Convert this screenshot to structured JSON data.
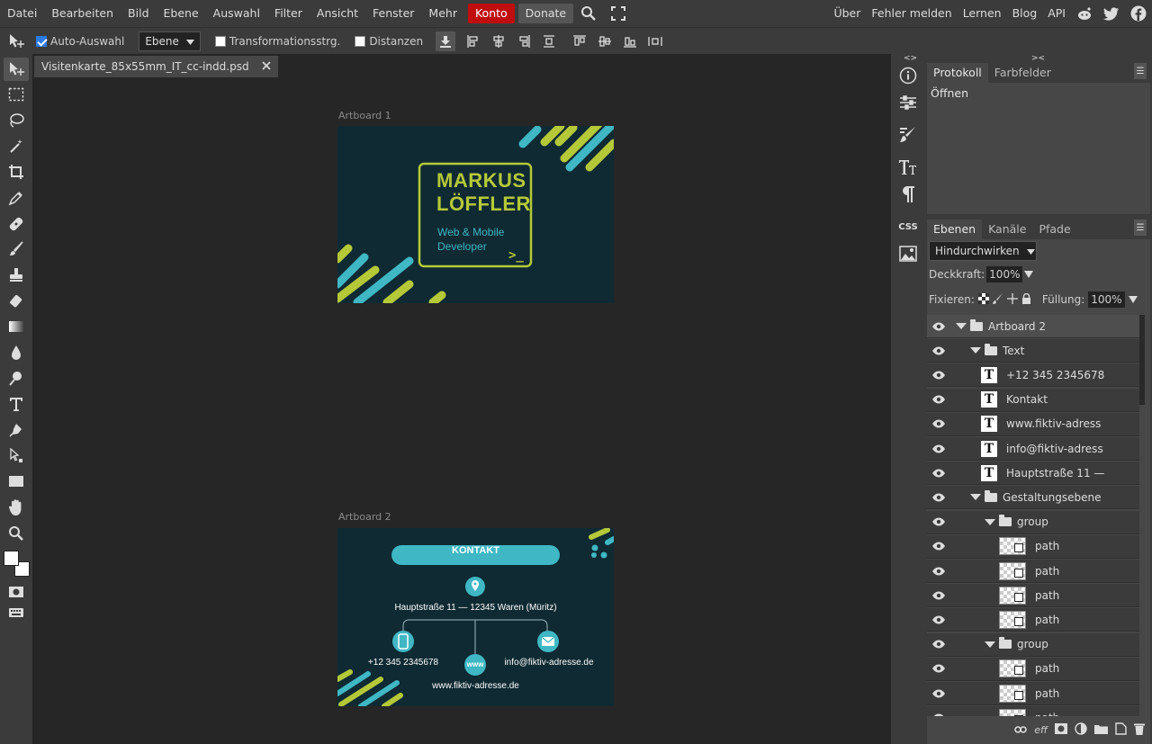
{
  "menu": {
    "items": [
      "Datei",
      "Bearbeiten",
      "Bild",
      "Ebene",
      "Auswahl",
      "Filter",
      "Ansicht",
      "Fenster",
      "Mehr"
    ],
    "konto": "Konto",
    "donate": "Donate",
    "right_items": [
      "Über",
      "Fehler melden",
      "Lernen",
      "Blog",
      "API"
    ]
  },
  "options": {
    "auto_select_label": "Auto-Auswahl",
    "auto_select_checked": true,
    "target_select": "Ebene",
    "transform_label": "Transformationsstrg.",
    "transform_checked": false,
    "distances_label": "Distanzen",
    "distances_checked": false
  },
  "document": {
    "tab_title": "Visitenkarte_85x55mm_IT_cc-indd.psd",
    "artboard1_label": "Artboard 1",
    "artboard2_label": "Artboard 2",
    "card_front": {
      "name_line1": "MARKUS",
      "name_line2": "LÖFFLER",
      "role_line1": "Web & Mobile",
      "role_line2": "Developer",
      "prompt_symbol": ">_"
    },
    "card_back": {
      "heading": "KONTAKT",
      "address": "Hauptstraße 11 — 12345 Waren (Müritz)",
      "phone": "+12 345 2345678",
      "email": "info@fiktiv-adresse.de",
      "web_badge": "www",
      "website": "www.fiktiv-adresse.de"
    },
    "colors": {
      "card_bg": "#0f2a33",
      "accent_teal": "#3fb7c4",
      "accent_lime": "#b5c938"
    }
  },
  "panels": {
    "history_tabs": [
      "Protokoll",
      "Farbfelder"
    ],
    "history_items": [
      "Öffnen"
    ],
    "layers_tabs": [
      "Ebenen",
      "Kanäle",
      "Pfade"
    ],
    "blend_mode": "Hindurchwirken",
    "opacity_label": "Deckkraft:",
    "opacity_value": "100%",
    "lock_label": "Fixieren:",
    "fill_label": "Füllung:",
    "fill_value": "100%",
    "mid_css_label": "CSS",
    "bottom_fx_label": "eff",
    "layers": [
      {
        "name": "Artboard 2",
        "kind": "folder",
        "indent": 0
      },
      {
        "name": "Text",
        "kind": "folder",
        "indent": 1
      },
      {
        "name": "+12 345 2345678",
        "kind": "text",
        "indent": 2
      },
      {
        "name": "Kontakt",
        "kind": "text",
        "indent": 2
      },
      {
        "name": "www.fiktiv-adress",
        "kind": "text",
        "indent": 2
      },
      {
        "name": "info@fiktiv-adress",
        "kind": "text",
        "indent": 2
      },
      {
        "name": "Hauptstraße 11 —",
        "kind": "text",
        "indent": 2
      },
      {
        "name": "Gestaltungsebene",
        "kind": "folder",
        "indent": 1
      },
      {
        "name": "group",
        "kind": "folder",
        "indent": 2
      },
      {
        "name": "path",
        "kind": "path",
        "indent": 3
      },
      {
        "name": "path",
        "kind": "path",
        "indent": 3
      },
      {
        "name": "path",
        "kind": "path",
        "indent": 3
      },
      {
        "name": "path",
        "kind": "path",
        "indent": 3
      },
      {
        "name": "group",
        "kind": "folder",
        "indent": 2
      },
      {
        "name": "path",
        "kind": "path",
        "indent": 3
      },
      {
        "name": "path",
        "kind": "path",
        "indent": 3
      },
      {
        "name": "path",
        "kind": "path",
        "indent": 3
      }
    ]
  }
}
